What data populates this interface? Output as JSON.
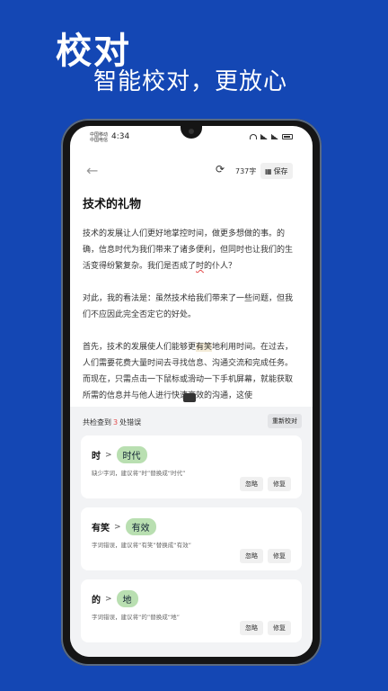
{
  "hero": {
    "title": "校对",
    "subtitle": "智能校对，更放心"
  },
  "status": {
    "carrier1": "中国移动",
    "carrier2": "中国电信",
    "time": "4:34"
  },
  "toolbar": {
    "char_count": "737字",
    "save_label": "保存"
  },
  "article": {
    "title": "技术的礼物",
    "p1_a": "技术的发展让人们更好地掌控时间，做更多想做的事。的确，信息时代为我们带来了诸多便利，但同时也让我们的生活变得纷繁复杂。我们是否成了",
    "p1_err": "时",
    "p1_b": "的仆人？",
    "p2": "对此，我的看法是：虽然技术给我们带来了一些问题，但我们不应因此完全否定它的好处。",
    "p3_a": "首先，技术的发展使人们能够更",
    "p3_err": "有笑",
    "p3_b": "地利用时间。在过去，人们需要花费大量时间去寻找信息、沟通交流和完成任务。而现在，只需点击一下鼠标或滑动一下手机屏幕，就能获取所需的信息并与他人进行快速高效的沟通，这使"
  },
  "panel": {
    "summary_prefix": "共检查到",
    "error_count": "3",
    "summary_suffix": "处错误",
    "recheck_label": "重新校对",
    "cards": [
      {
        "from": "时",
        "to": "时代",
        "desc": "缺少字词，建议将“时”替换成“时代”",
        "ignore": "忽略",
        "fix": "修复"
      },
      {
        "from": "有笑",
        "to": "有效",
        "desc": "字词错误，建议将“有笑”替换成“有效”",
        "ignore": "忽略",
        "fix": "修复"
      },
      {
        "from": "的",
        "to": "地",
        "desc": "字词错误，建议将“的”替换成“地”",
        "ignore": "忽略",
        "fix": "修复"
      }
    ]
  },
  "colors": {
    "background": "#1447b4",
    "error_count": "#e24a4a",
    "suggestion_pill": "#b9dfb1"
  },
  "icons": {
    "back": "arrow-left-icon",
    "refresh": "refresh-icon",
    "save": "save-icon",
    "keyboard": "keyboard-icon"
  }
}
